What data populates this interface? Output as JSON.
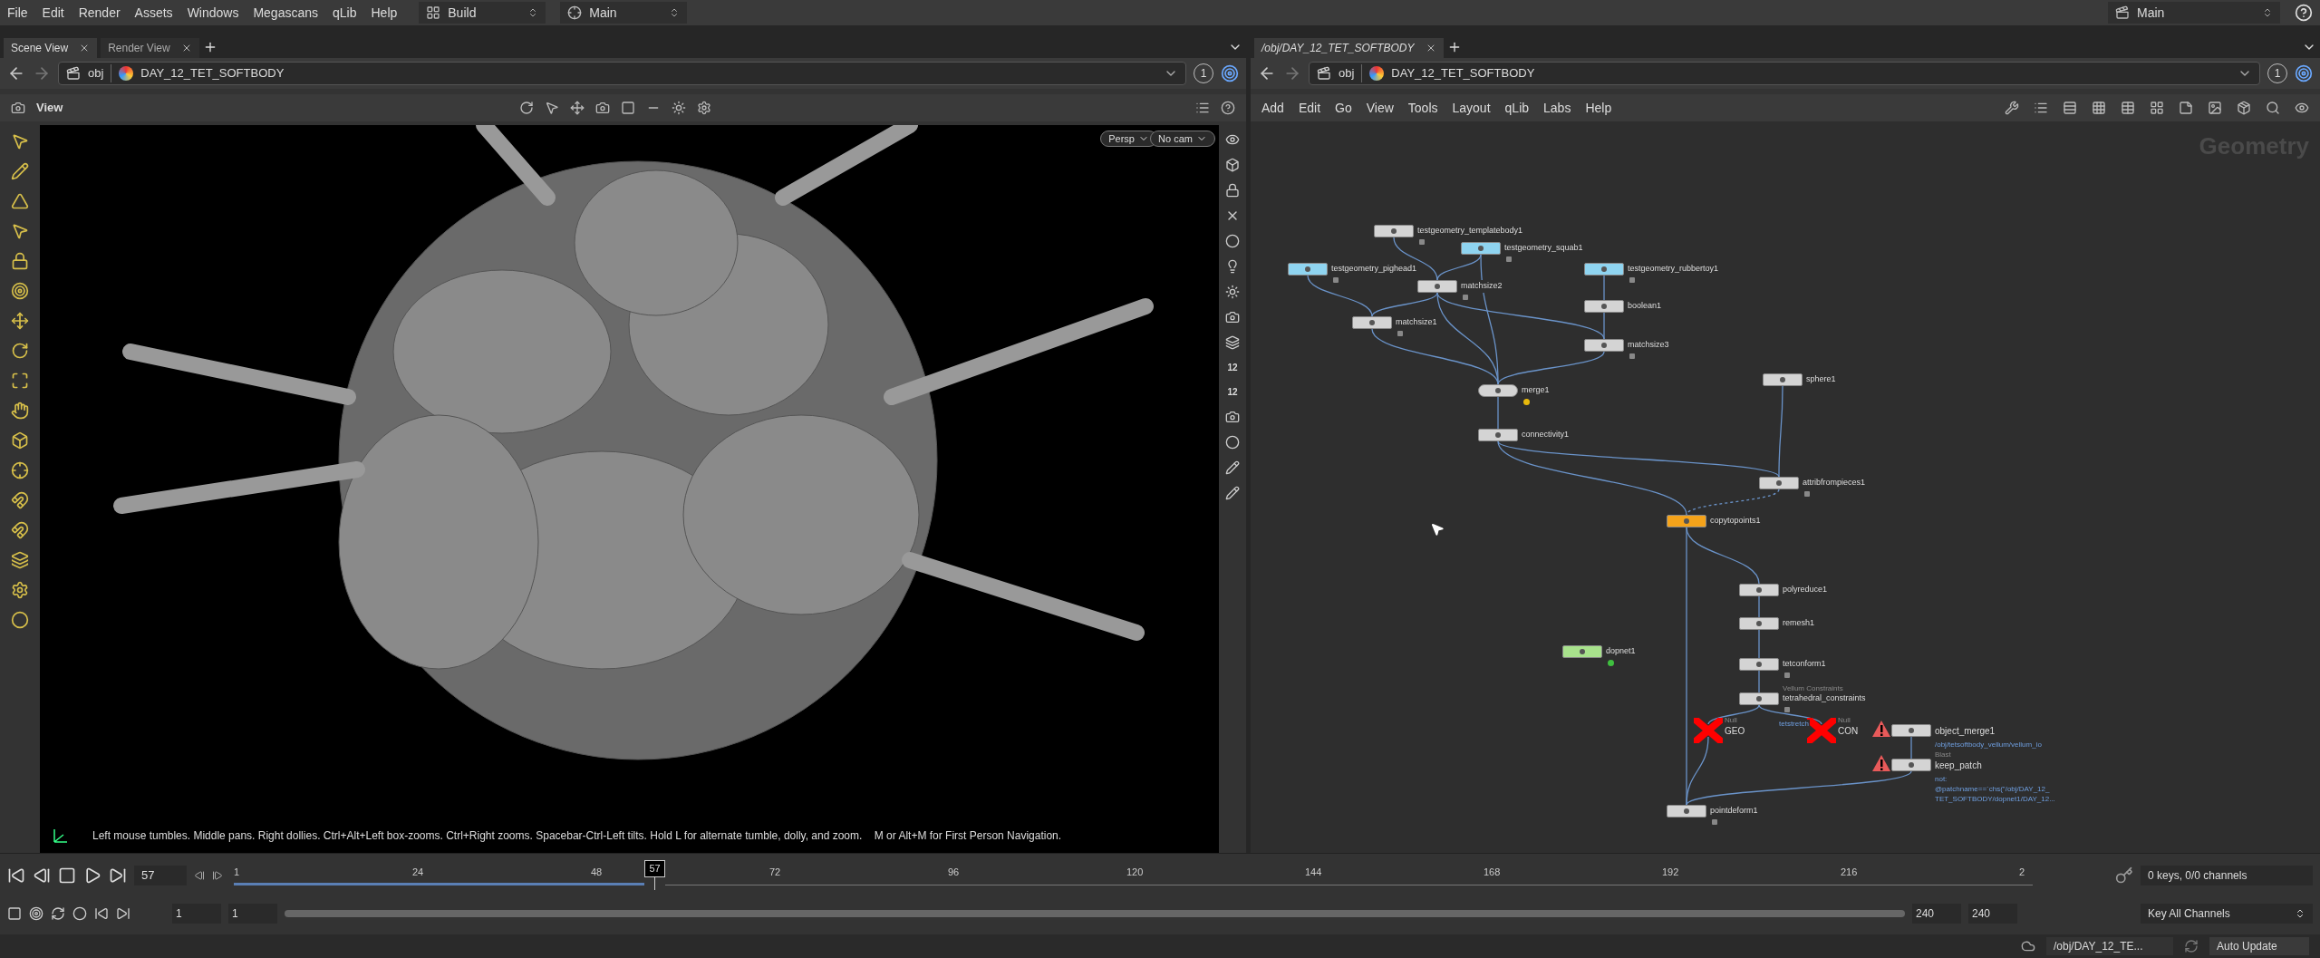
{
  "menu_bar": {
    "items": [
      "File",
      "Edit",
      "Render",
      "Assets",
      "Windows",
      "Megascans",
      "qLib",
      "Help"
    ],
    "desktop": "Build",
    "context": "Main",
    "right_context": "Main"
  },
  "left_pane": {
    "tabs": [
      {
        "label": "Scene View",
        "selected": true
      },
      {
        "label": "Render View",
        "selected": false
      }
    ],
    "path": [
      "obj",
      "DAY_12_TET_SOFTBODY"
    ],
    "path_badge": "1",
    "viewer_title": "View",
    "camera_buttons": [
      "Persp",
      "No cam"
    ],
    "tool_labels": [
      "12",
      "12"
    ],
    "status_text": "Left mouse tumbles. Middle pans. Right dollies. Ctrl+Alt+Left box-zooms. Ctrl+Right zooms. Spacebar-Ctrl-Left tilts. Hold L for alternate tumble, dolly, and zoom.    M or Alt+M for First Person Navigation."
  },
  "network_pane": {
    "tabs": [
      {
        "label": "/obj/DAY_12_TET_SOFTBODY",
        "selected": true
      }
    ],
    "path": [
      "obj",
      "DAY_12_TET_SOFTBODY"
    ],
    "path_badge": "1",
    "menu": [
      "Add",
      "Edit",
      "Go",
      "View",
      "Tools",
      "Layout",
      "qLib",
      "Labs",
      "Help"
    ],
    "context_label": "Geometry",
    "nodes": [
      {
        "name": "testgeometry_templatebody1",
        "kind": "normal",
        "color": "#d4d4d4",
        "locked": true
      },
      {
        "name": "testgeometry_squab1",
        "kind": "normal",
        "color": "#8fd4f0",
        "locked": true
      },
      {
        "name": "testgeometry_pighead1",
        "kind": "normal",
        "color": "#8fd4f0",
        "locked": true
      },
      {
        "name": "testgeometry_rubbertoy1",
        "kind": "normal",
        "color": "#8fd4f0",
        "locked": true
      },
      {
        "name": "matchsize2",
        "kind": "normal",
        "color": "#d4d4d4",
        "locked": true
      },
      {
        "name": "boolean1",
        "kind": "normal",
        "color": "#d4d4d4",
        "locked": false
      },
      {
        "name": "matchsize1",
        "kind": "normal",
        "color": "#d4d4d4",
        "locked": true
      },
      {
        "name": "matchsize3",
        "kind": "normal",
        "color": "#d4d4d4",
        "locked": true
      },
      {
        "name": "merge1",
        "kind": "merge",
        "color": "#d4d4d4",
        "locked": false,
        "badge": {
          "color": "#e8b90c"
        }
      },
      {
        "name": "sphere1",
        "kind": "normal",
        "color": "#d4d4d4",
        "locked": false
      },
      {
        "name": "connectivity1",
        "kind": "normal",
        "color": "#d4d4d4",
        "locked": false
      },
      {
        "name": "attribfrompieces1",
        "kind": "normal",
        "color": "#d4d4d4",
        "locked": true
      },
      {
        "name": "copytopoints1",
        "kind": "normal",
        "color": "#f5a31a",
        "locked": false
      },
      {
        "name": "polyreduce1",
        "kind": "normal",
        "color": "#d4d4d4",
        "locked": false
      },
      {
        "name": "remesh1",
        "kind": "normal",
        "color": "#d4d4d4",
        "locked": false
      },
      {
        "name": "tetconform1",
        "kind": "normal",
        "color": "#d4d4d4",
        "locked": true
      },
      {
        "name": "tetrahedral_constraints",
        "kind": "normal",
        "color": "#d4d4d4",
        "locked": true,
        "subtitle": "Vellum Constraints"
      },
      {
        "name": "GEO",
        "kind": "null",
        "color": "#ff0000",
        "locked": false,
        "subtitle": "Null"
      },
      {
        "name": "CON",
        "kind": "null",
        "color": "#ff0000",
        "locked": false,
        "subtitle": "Null",
        "wire_label": "tetstretch"
      },
      {
        "name": "object_merge1",
        "kind": "error",
        "color": "#d4d4d4",
        "locked": false,
        "note": [
          "/obj/tetsoftbody_vellum/vellum_io"
        ]
      },
      {
        "name": "keep_patch",
        "kind": "error",
        "color": "#d4d4d4",
        "locked": false,
        "subtitle": "Blast",
        "note": [
          "not:",
          "@patchname==`chs(\"/obj/DAY_12_",
          "TET_SOFTBODY/dopnet1/DAY_12..."
        ]
      },
      {
        "name": "pointdeform1",
        "kind": "normal",
        "color": "#d4d4d4",
        "locked": true
      },
      {
        "name": "dopnet1",
        "kind": "normal",
        "color": "#a8e28c",
        "locked": false,
        "badge": {
          "color": "#3fbf3f"
        }
      }
    ]
  },
  "timeline": {
    "current_frame": "57",
    "playhead_label": "57",
    "level": 0.234,
    "ticks": [
      "1",
      "24",
      "48",
      "72",
      "96",
      "120",
      "144",
      "168",
      "192",
      "216",
      "2"
    ],
    "range_start": [
      "1",
      "1"
    ],
    "range_end": [
      "240",
      "240"
    ],
    "keys_info": "0 keys, 0/0 channels",
    "key_button": "Key All Channels"
  },
  "status_bar": {
    "path": "/obj/DAY_12_TE...",
    "update_mode": "Auto Update"
  }
}
